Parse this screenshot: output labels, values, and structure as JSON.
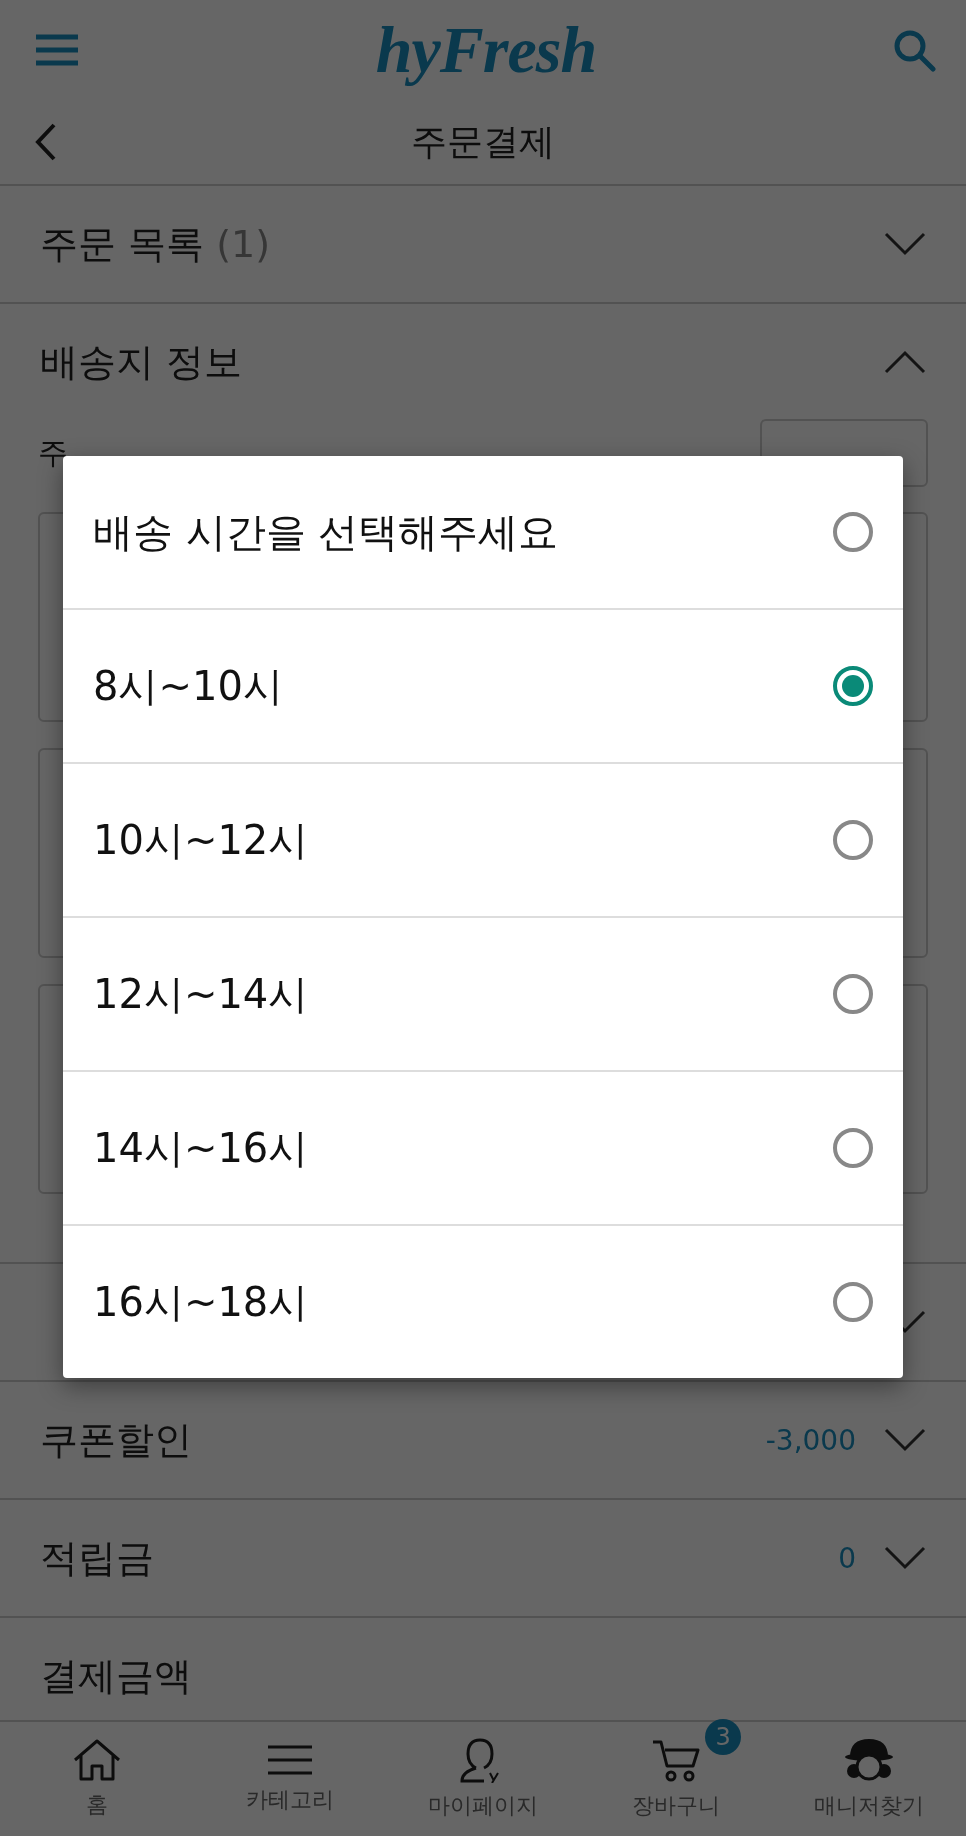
{
  "header": {
    "logo": "hyFresh",
    "title": "주문결제"
  },
  "sections": [
    {
      "label": "주문 목록",
      "count": "(1)",
      "expanded": false
    },
    {
      "label": "배송지 정보",
      "expanded": true
    }
  ],
  "address_form": {
    "label": "주"
  },
  "summary": [
    {
      "expanded": false
    },
    {
      "label": "쿠폰할인",
      "value": "-3,000",
      "expanded": false
    },
    {
      "label": "적립금",
      "value": "0",
      "expanded": false
    },
    {
      "label": "결제금액"
    }
  ],
  "nav": [
    {
      "kind": "home",
      "label": "홈"
    },
    {
      "kind": "menu",
      "label": "카테고리"
    },
    {
      "kind": "my",
      "label": "마이페이지"
    },
    {
      "kind": "cart",
      "label": "장바구니",
      "badge": "3"
    },
    {
      "kind": "manager",
      "label": "매니저찾기"
    }
  ],
  "dialog": {
    "options": [
      {
        "label": "배송 시간을 선택해주세요",
        "selected": false
      },
      {
        "label": "8시~10시",
        "selected": true
      },
      {
        "label": "10시~12시",
        "selected": false
      },
      {
        "label": "12시~14시",
        "selected": false
      },
      {
        "label": "14시~16시",
        "selected": false
      },
      {
        "label": "16시~18시",
        "selected": false
      }
    ]
  }
}
